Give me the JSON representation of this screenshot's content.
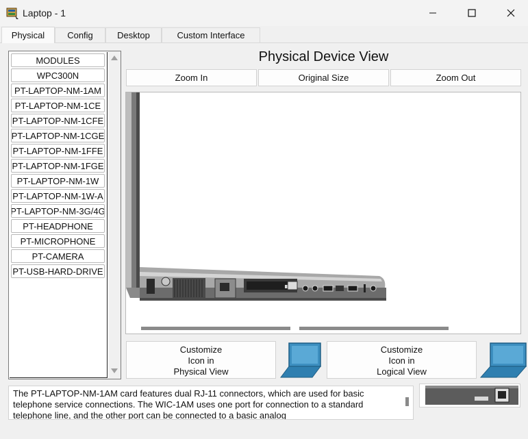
{
  "window": {
    "title": "Laptop - 1",
    "icon": "packet-tracer-icon",
    "controls": [
      "minimize-icon",
      "maximize-icon",
      "close-icon"
    ]
  },
  "tabs": [
    {
      "label": "Physical",
      "active": true
    },
    {
      "label": "Config",
      "active": false
    },
    {
      "label": "Desktop",
      "active": false
    },
    {
      "label": "Custom Interface",
      "active": false
    }
  ],
  "modules": {
    "items": [
      "MODULES",
      "WPC300N",
      "PT-LAPTOP-NM-1AM",
      "PT-LAPTOP-NM-1CE",
      "PT-LAPTOP-NM-1CFE",
      "PT-LAPTOP-NM-1CGE",
      "PT-LAPTOP-NM-1FFE",
      "PT-LAPTOP-NM-1FGE",
      "PT-LAPTOP-NM-1W",
      "PT-LAPTOP-NM-1W-A",
      "PT-LAPTOP-NM-3G/4G",
      "PT-HEADPHONE",
      "PT-MICROPHONE",
      "PT-CAMERA",
      "PT-USB-HARD-DRIVE"
    ]
  },
  "view": {
    "title": "Physical Device View",
    "zoom_in": "Zoom In",
    "original_size": "Original Size",
    "zoom_out": "Zoom Out"
  },
  "customize": {
    "physical_lines": [
      "Customize",
      "Icon in",
      "Physical View"
    ],
    "logical_lines": [
      "Customize",
      "Icon in",
      "Logical View"
    ]
  },
  "description": "The PT-LAPTOP-NM-1AM card features dual RJ-11 connectors, which are used for basic telephone service connections. The WIC-1AM uses one port for connection to a standard telephone line, and the other port can be connected to a basic analog",
  "colors": {
    "accent_laptop": "#3d8fc0",
    "laptop_dark": "#555555"
  }
}
